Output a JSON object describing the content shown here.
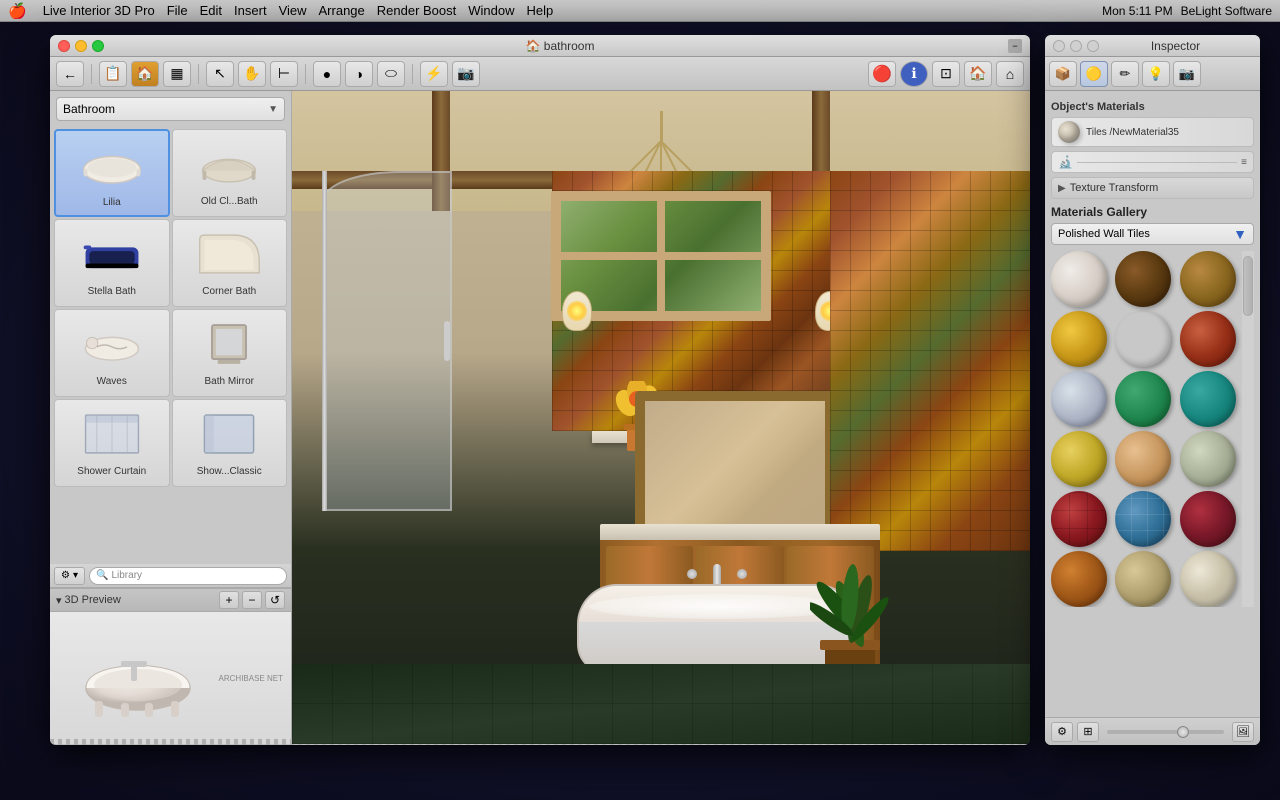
{
  "menubar": {
    "apple": "🍎",
    "app_name": "Live Interior 3D Pro",
    "menus": [
      "File",
      "Edit",
      "Insert",
      "View",
      "Arrange",
      "Render Boost",
      "Window",
      "Help"
    ],
    "right_items": [
      "status_icons",
      "Mon 5:11 PM",
      "BeLight Software"
    ],
    "time": "Mon 5:11 PM",
    "company": "BeLight Software"
  },
  "window": {
    "title": "🏠 bathroom",
    "tab_label": "bathroom"
  },
  "sidebar": {
    "category_label": "Bathroom",
    "items": [
      {
        "id": "lilia",
        "label": "Lilia",
        "selected": true
      },
      {
        "id": "old-bath",
        "label": "Old Cl...Bath"
      },
      {
        "id": "stella-bath",
        "label": "Stella Bath"
      },
      {
        "id": "corner-bath",
        "label": "Corner Bath"
      },
      {
        "id": "waves",
        "label": "Waves"
      },
      {
        "id": "bath-mirror",
        "label": "Bath Mirror"
      },
      {
        "id": "shower-curtain",
        "label": "Shower Curtain"
      },
      {
        "id": "show-classic",
        "label": "Show...Classic"
      }
    ],
    "bottom_toolbar": {
      "gear_btn": "⚙",
      "search_placeholder": "Library",
      "search_icon": "🔍"
    },
    "preview_section": {
      "label": "3D Preview",
      "zoom_in": "+",
      "zoom_out": "−",
      "rotate": "↺",
      "watermark": "ARCHIBASE NET"
    }
  },
  "inspector": {
    "title": "Inspector",
    "tabs": [
      {
        "id": "objects",
        "icon": "📦",
        "active": false
      },
      {
        "id": "materials",
        "icon": "🟡",
        "active": true
      },
      {
        "id": "edit",
        "icon": "✏️",
        "active": false
      },
      {
        "id": "lights",
        "icon": "💡",
        "active": false
      },
      {
        "id": "camera",
        "icon": "📷",
        "active": false
      }
    ],
    "objects_material": {
      "label": "Object's Materials",
      "material_name": "Tiles /NewMaterial35",
      "sphere_type": "tiles"
    },
    "texture_transform": {
      "label": "Texture Transform",
      "collapsed": true
    },
    "materials_gallery": {
      "label": "Materials Gallery",
      "dropdown_value": "Polished Wall Tiles",
      "swatches": [
        {
          "id": "s1",
          "color": "#e0d8d0",
          "type": "white-marble"
        },
        {
          "id": "s2",
          "color": "#6a4020",
          "type": "dark-brown"
        },
        {
          "id": "s3",
          "color": "#8b6a30",
          "type": "medium-brown"
        },
        {
          "id": "s4",
          "color": "#d4a020",
          "type": "gold-yellow"
        },
        {
          "id": "s5",
          "color": "#2a4880",
          "type": "dark-blue"
        },
        {
          "id": "s6",
          "color": "#a03020",
          "type": "terracotta-red"
        },
        {
          "id": "s7",
          "color": "#c0c8d8",
          "type": "light-grey-blue"
        },
        {
          "id": "s8",
          "color": "#2a7050",
          "type": "teal-green"
        },
        {
          "id": "s9",
          "color": "#1a6060",
          "type": "dark-teal"
        },
        {
          "id": "s10",
          "color": "#d4b840",
          "type": "yellow-gold"
        },
        {
          "id": "s11",
          "color": "#d4a870",
          "type": "peach"
        },
        {
          "id": "s12",
          "color": "#c0c8b0",
          "type": "sage-grey"
        },
        {
          "id": "s13",
          "color": "#8a1820",
          "type": "dark-red-tile"
        },
        {
          "id": "s14",
          "color": "#4080a0",
          "type": "blue-tile"
        },
        {
          "id": "s15",
          "color": "#801820",
          "type": "maroon"
        },
        {
          "id": "s16",
          "color": "#b85818",
          "type": "orange-brown"
        },
        {
          "id": "s17",
          "color": "#c0b890",
          "type": "sandy"
        },
        {
          "id": "s18",
          "color": "#d8c8a0",
          "type": "cream-tile"
        }
      ]
    },
    "bottom_bar": {
      "add_btn": "+",
      "delete_btn": "−",
      "zoom_label": "zoom",
      "image_btn": "🖼"
    }
  }
}
